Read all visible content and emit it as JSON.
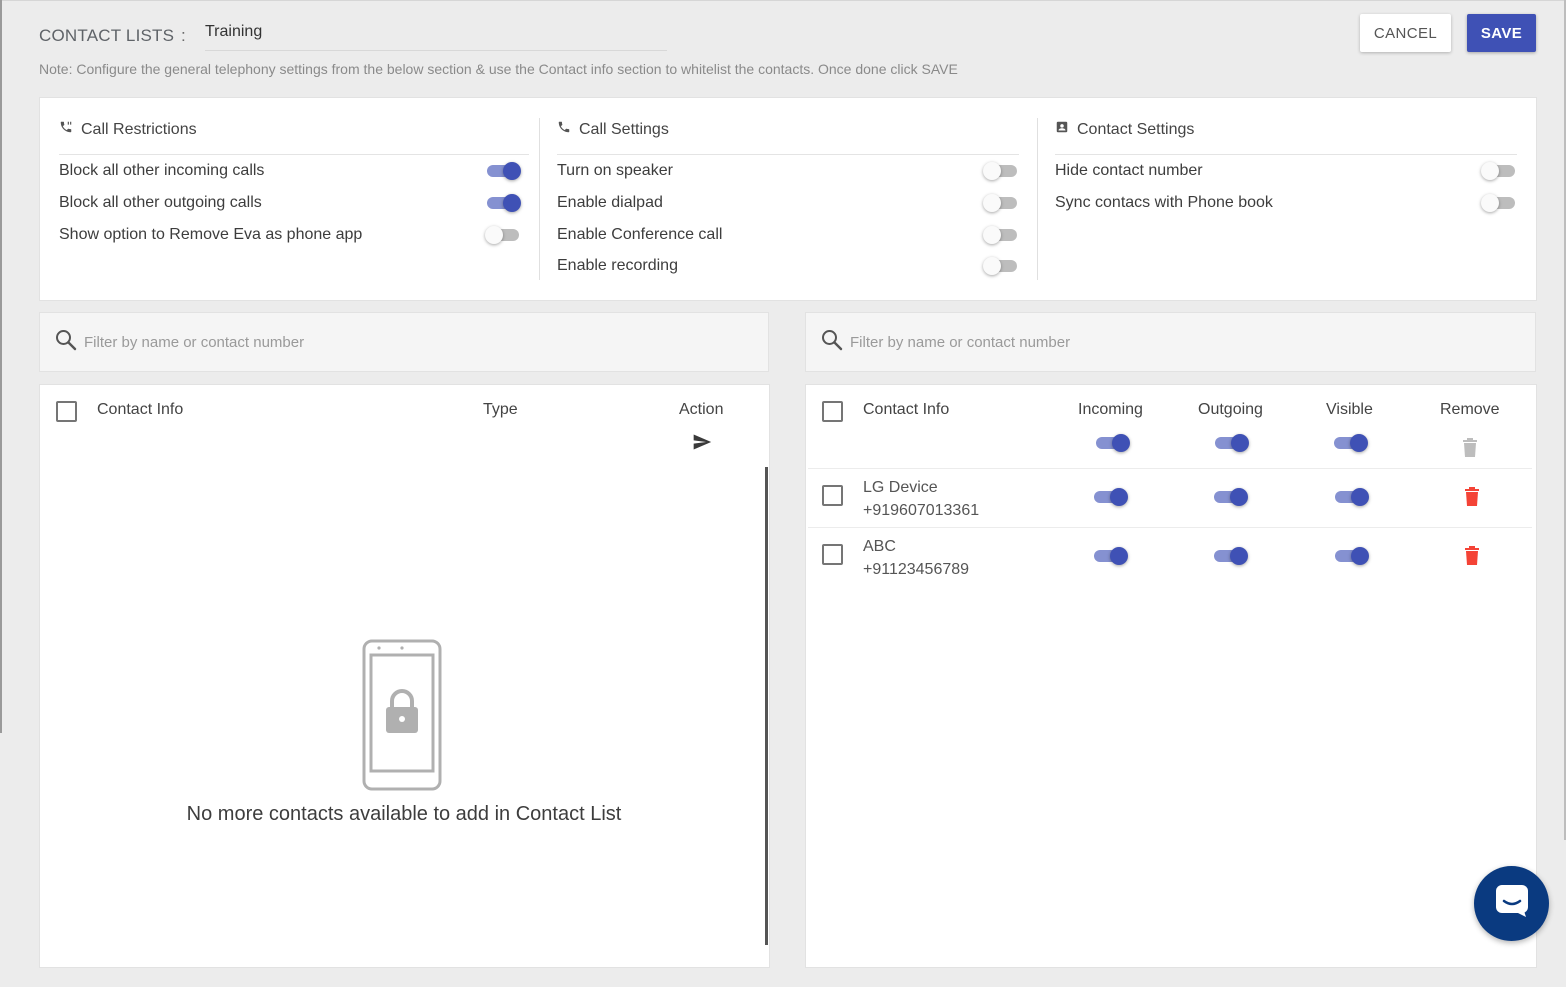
{
  "header": {
    "label": "CONTACT LISTS",
    "separator": ":",
    "list_name": "Training",
    "note": "Note: Configure the general telephony settings from the below section & use the Contact info section to whitelist the contacts. Once done click SAVE",
    "cancel_label": "CANCEL",
    "save_label": "SAVE"
  },
  "settings": {
    "call_restrictions": {
      "title": "Call Restrictions",
      "icon": "phone-forward-icon",
      "items": [
        {
          "label": "Block all other incoming calls",
          "on": true
        },
        {
          "label": "Block all other outgoing calls",
          "on": true
        },
        {
          "label": "Show option to Remove Eva as phone app",
          "on": false
        }
      ]
    },
    "call_settings": {
      "title": "Call Settings",
      "icon": "phone-icon",
      "items": [
        {
          "label": "Turn on speaker",
          "on": false
        },
        {
          "label": "Enable dialpad",
          "on": false
        },
        {
          "label": "Enable Conference call",
          "on": false
        },
        {
          "label": "Enable recording",
          "on": false
        }
      ]
    },
    "contact_settings": {
      "title": "Contact Settings",
      "icon": "contact-card-icon",
      "items": [
        {
          "label": "Hide contact number",
          "on": false
        },
        {
          "label": "Sync contacs with Phone book",
          "on": false
        }
      ]
    }
  },
  "left_panel": {
    "search_placeholder": "Filter by name or contact number",
    "columns": {
      "info": "Contact Info",
      "type": "Type",
      "action": "Action"
    },
    "empty_message": "No more contacts available to add in Contact List"
  },
  "right_panel": {
    "search_placeholder": "Filter by name or contact number",
    "columns": {
      "info": "Contact Info",
      "incoming": "Incoming",
      "outgoing": "Outgoing",
      "visible": "Visible",
      "remove": "Remove"
    },
    "header_toggles": {
      "incoming": true,
      "outgoing": true,
      "visible": true
    },
    "contacts": [
      {
        "name": "LG Device",
        "number": "+919607013361",
        "incoming": true,
        "outgoing": true,
        "visible": true
      },
      {
        "name": "ABC",
        "number": "+91123456789",
        "incoming": true,
        "outgoing": true,
        "visible": true
      }
    ]
  },
  "colors": {
    "accent": "#3f51b5",
    "toggle_track_on": "#8591d1",
    "delete_red": "#f44336",
    "chat_fab": "#0a3a80"
  }
}
